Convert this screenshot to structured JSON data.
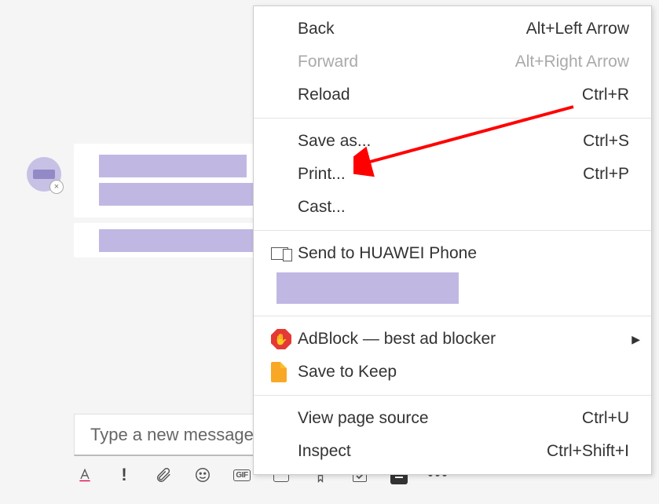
{
  "composer": {
    "placeholder": "Type a new message"
  },
  "context_menu": {
    "back": {
      "label": "Back",
      "shortcut": "Alt+Left Arrow"
    },
    "forward": {
      "label": "Forward",
      "shortcut": "Alt+Right Arrow"
    },
    "reload": {
      "label": "Reload",
      "shortcut": "Ctrl+R"
    },
    "save_as": {
      "label": "Save as...",
      "shortcut": "Ctrl+S"
    },
    "print": {
      "label": "Print...",
      "shortcut": "Ctrl+P"
    },
    "cast": {
      "label": "Cast..."
    },
    "send_to_phone": {
      "label": "Send to HUAWEI Phone"
    },
    "adblock": {
      "label": "AdBlock — best ad blocker"
    },
    "save_to_keep": {
      "label": "Save to Keep"
    },
    "view_source": {
      "label": "View page source",
      "shortcut": "Ctrl+U"
    },
    "inspect": {
      "label": "Inspect",
      "shortcut": "Ctrl+Shift+I"
    }
  },
  "toolbar": {
    "gif": "GIF",
    "more": "•••"
  }
}
